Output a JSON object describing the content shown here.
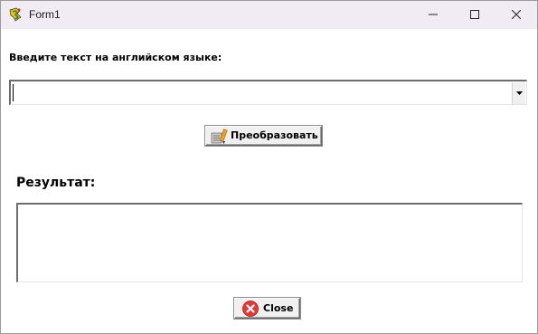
{
  "window": {
    "title": "Form1",
    "app_icon": "delphi-app-icon",
    "controls": {
      "minimize": "minimize-icon",
      "maximize": "maximize-icon",
      "close": "close-icon"
    }
  },
  "input_section": {
    "label": "Введите текст на английском языке:",
    "combo_value": "",
    "dropdown_icon": "dropdown-arrow-icon"
  },
  "convert_button": {
    "label": "Преобразовать",
    "icon": "convert-icon"
  },
  "result_section": {
    "label": "Результат:",
    "value": ""
  },
  "close_button": {
    "label": "Close",
    "icon": "red-x-icon"
  },
  "colors": {
    "titlebar": "#f1ebf4",
    "window_bg": "#ffffff",
    "button_face": "#f0f0f0",
    "close_icon_red": "#e53935"
  }
}
